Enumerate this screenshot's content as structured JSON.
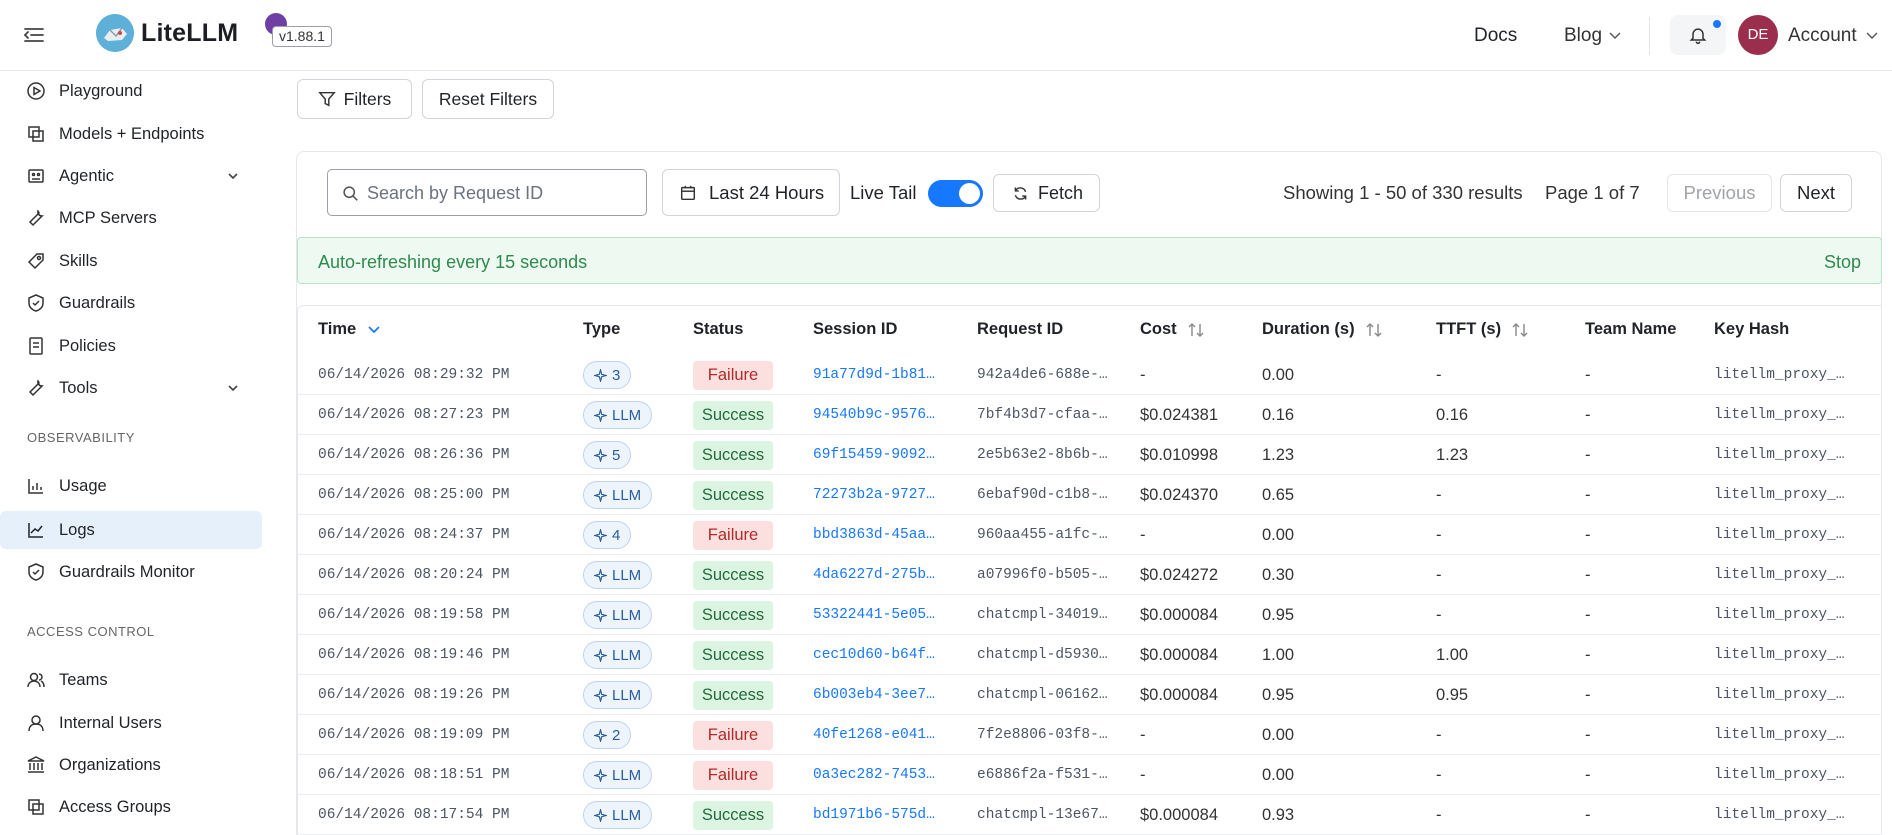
{
  "header": {
    "brand": "LiteLLM",
    "version": "v1.88.1",
    "docs": "Docs",
    "blog": "Blog",
    "avatar_initials": "DE",
    "account": "Account"
  },
  "sidebar": {
    "items": [
      {
        "label": "Playground",
        "icon": "play-circle-icon"
      },
      {
        "label": "Models + Endpoints",
        "icon": "block-icon"
      },
      {
        "label": "Agentic",
        "icon": "robot-icon"
      },
      {
        "label": "MCP Servers",
        "icon": "tool-icon"
      },
      {
        "label": "Skills",
        "icon": "rocket-icon"
      },
      {
        "label": "Guardrails",
        "icon": "shield-icon"
      },
      {
        "label": "Policies",
        "icon": "file-icon"
      },
      {
        "label": "Tools",
        "icon": "tool-icon"
      }
    ],
    "observability_title": "OBSERVABILITY",
    "observability_items": [
      {
        "label": "Usage",
        "icon": "bar-chart-icon"
      },
      {
        "label": "Logs",
        "icon": "line-chart-icon"
      },
      {
        "label": "Guardrails Monitor",
        "icon": "shield-icon"
      }
    ],
    "access_title": "ACCESS CONTROL",
    "access_items": [
      {
        "label": "Teams",
        "icon": "team-icon"
      },
      {
        "label": "Internal Users",
        "icon": "user-icon"
      },
      {
        "label": "Organizations",
        "icon": "bank-icon"
      },
      {
        "label": "Access Groups",
        "icon": "block-icon"
      }
    ]
  },
  "toolbar": {
    "filters": "Filters",
    "reset_filters": "Reset Filters"
  },
  "controls": {
    "search_placeholder": "Search by Request ID",
    "time_range": "Last 24 Hours",
    "live_tail": "Live Tail",
    "live_tail_on": true,
    "fetch": "Fetch",
    "showing": "Showing 1 - 50 of 330 results",
    "page": "Page 1 of 7",
    "previous": "Previous",
    "next": "Next"
  },
  "refresh": {
    "message": "Auto-refreshing every 15 seconds",
    "stop": "Stop"
  },
  "table": {
    "columns": [
      "Time",
      "Type",
      "Status",
      "Session ID",
      "Request ID",
      "Cost",
      "Duration (s)",
      "TTFT (s)",
      "Team Name",
      "Key Hash"
    ],
    "rows": [
      {
        "time": "06/14/2026 08:29:32 PM",
        "type": "3",
        "status": "Failure",
        "session": "91a77d9d-1b81…",
        "request": "942a4de6-688e-…",
        "cost": "-",
        "duration": "0.00",
        "ttft": "-",
        "team": "-",
        "key": "litellm_proxy_…"
      },
      {
        "time": "06/14/2026 08:27:23 PM",
        "type": "LLM",
        "status": "Success",
        "session": "94540b9c-9576…",
        "request": "7bf4b3d7-cfaa-…",
        "cost": "$0.024381",
        "duration": "0.16",
        "ttft": "0.16",
        "team": "-",
        "key": "litellm_proxy_…"
      },
      {
        "time": "06/14/2026 08:26:36 PM",
        "type": "5",
        "status": "Success",
        "session": "69f15459-9092…",
        "request": "2e5b63e2-8b6b-…",
        "cost": "$0.010998",
        "duration": "1.23",
        "ttft": "1.23",
        "team": "-",
        "key": "litellm_proxy_…"
      },
      {
        "time": "06/14/2026 08:25:00 PM",
        "type": "LLM",
        "status": "Success",
        "session": "72273b2a-9727…",
        "request": "6ebaf90d-c1b8-…",
        "cost": "$0.024370",
        "duration": "0.65",
        "ttft": "-",
        "team": "-",
        "key": "litellm_proxy_…"
      },
      {
        "time": "06/14/2026 08:24:37 PM",
        "type": "4",
        "status": "Failure",
        "session": "bbd3863d-45aa…",
        "request": "960aa455-a1fc-…",
        "cost": "-",
        "duration": "0.00",
        "ttft": "-",
        "team": "-",
        "key": "litellm_proxy_…"
      },
      {
        "time": "06/14/2026 08:20:24 PM",
        "type": "LLM",
        "status": "Success",
        "session": "4da6227d-275b…",
        "request": "a07996f0-b505-…",
        "cost": "$0.024272",
        "duration": "0.30",
        "ttft": "-",
        "team": "-",
        "key": "litellm_proxy_…"
      },
      {
        "time": "06/14/2026 08:19:58 PM",
        "type": "LLM",
        "status": "Success",
        "session": "53322441-5e05…",
        "request": "chatcmpl-34019…",
        "cost": "$0.000084",
        "duration": "0.95",
        "ttft": "-",
        "team": "-",
        "key": "litellm_proxy_…"
      },
      {
        "time": "06/14/2026 08:19:46 PM",
        "type": "LLM",
        "status": "Success",
        "session": "cec10d60-b64f…",
        "request": "chatcmpl-d5930…",
        "cost": "$0.000084",
        "duration": "1.00",
        "ttft": "1.00",
        "team": "-",
        "key": "litellm_proxy_…"
      },
      {
        "time": "06/14/2026 08:19:26 PM",
        "type": "LLM",
        "status": "Success",
        "session": "6b003eb4-3ee7…",
        "request": "chatcmpl-06162…",
        "cost": "$0.000084",
        "duration": "0.95",
        "ttft": "0.95",
        "team": "-",
        "key": "litellm_proxy_…"
      },
      {
        "time": "06/14/2026 08:19:09 PM",
        "type": "2",
        "status": "Failure",
        "session": "40fe1268-e041…",
        "request": "7f2e8806-03f8-…",
        "cost": "-",
        "duration": "0.00",
        "ttft": "-",
        "team": "-",
        "key": "litellm_proxy_…"
      },
      {
        "time": "06/14/2026 08:18:51 PM",
        "type": "LLM",
        "status": "Failure",
        "session": "0a3ec282-7453…",
        "request": "e6886f2a-f531-…",
        "cost": "-",
        "duration": "0.00",
        "ttft": "-",
        "team": "-",
        "key": "litellm_proxy_…"
      },
      {
        "time": "06/14/2026 08:17:54 PM",
        "type": "LLM",
        "status": "Success",
        "session": "bd1971b6-575d…",
        "request": "chatcmpl-13e67…",
        "cost": "$0.000084",
        "duration": "0.93",
        "ttft": "-",
        "team": "-",
        "key": "litellm_proxy_…"
      }
    ]
  },
  "colors": {
    "accent": "#1677ff",
    "success_bg": "#dcf5e3",
    "failure_bg": "#fce0e0",
    "refresh_bg": "#edf9f1"
  }
}
